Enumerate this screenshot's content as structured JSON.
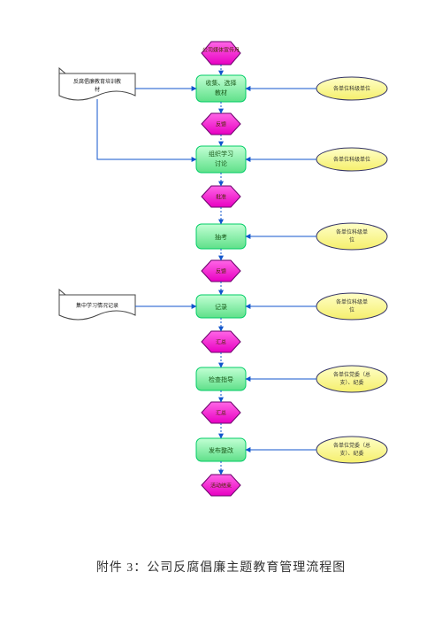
{
  "caption": "附件 3：公司反腐倡廉主题教育管理流程图",
  "hex": {
    "h1": "公司媒体宣传月",
    "h2": "反馈",
    "h3": "批准",
    "h4": "反馈",
    "h5": "汇总",
    "h6": "汇总",
    "h7": "活动结束"
  },
  "box": {
    "b1a": "收集、选择",
    "b1b": "教材",
    "b2a": "组织学习",
    "b2b": "讨论",
    "b3": "抽考",
    "b4": "记录",
    "b5": "检查指导",
    "b6": "发布整改"
  },
  "oval": {
    "o1": "各单位科级单位",
    "o2": "各单位科级单位",
    "o3a": "各单位科级单",
    "o3b": "位",
    "o4a": "各单位科级单",
    "o4b": "位",
    "o5a": "各单位党委（总",
    "o5b": "支）、纪委",
    "o6a": "各单位党委（总",
    "o6b": "支）、纪委"
  },
  "doc": {
    "d1a": "反腐倡廉教育培训教",
    "d1b": "材",
    "d2": "集中学习情况记录"
  }
}
